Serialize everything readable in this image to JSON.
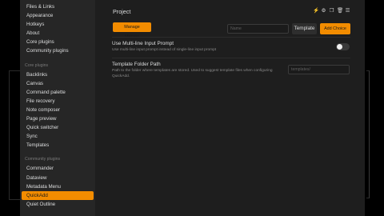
{
  "sidebar": {
    "options": [
      "Files & Links",
      "Appearance",
      "Hotkeys",
      "About",
      "Core plugins",
      "Community plugins"
    ],
    "core_heading": "Core plugins",
    "core": [
      "Backlinks",
      "Canvas",
      "Command palette",
      "File recovery",
      "Note composer",
      "Page preview",
      "Quick switcher",
      "Sync",
      "Templates"
    ],
    "community_heading": "Community plugins",
    "community": [
      "Commander",
      "Dataview",
      "Metadata Menu",
      "QuickAdd",
      "Quiet Outline"
    ],
    "active": "QuickAdd"
  },
  "main": {
    "project_title": "Project",
    "icons": [
      "bolt-icon",
      "gear-icon",
      "copy-icon",
      "trash-icon",
      "menu-icon"
    ],
    "icon_glyphs": [
      "⚡",
      "⚙",
      "❐",
      "🗑",
      "☰"
    ],
    "manage_macros_label": "Manage Macros",
    "name_placeholder": "Name",
    "type_value": "Template",
    "add_choice_label": "Add Choice",
    "multiline": {
      "title": "Use Multi-line Input Prompt",
      "desc": "Use multi-line input prompt instead of single-line input prompt",
      "enabled": false
    },
    "template_folder": {
      "title": "Template Folder Path",
      "desc_line1": "Path to the folder where templates are stored. Used to suggest template files when configuring",
      "desc_line2": "QuickAdd.",
      "placeholder": "templates/"
    }
  },
  "colors": {
    "accent": "#f28c00",
    "sidebar_bg": "#262626",
    "content_bg": "#1e1e1e"
  }
}
